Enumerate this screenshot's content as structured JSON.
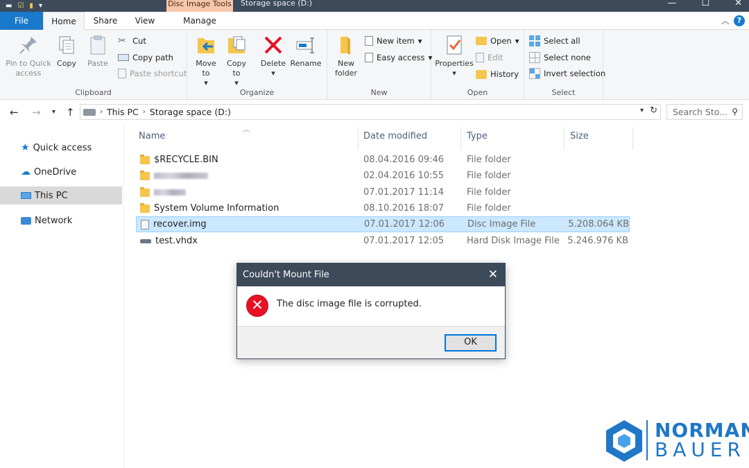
{
  "window": {
    "title": "Storage space (D:)",
    "context_tab": "Disc Image Tools",
    "controls": {
      "minimize": "—",
      "maximize": "☐",
      "close": "✕"
    }
  },
  "tabs": [
    {
      "label": "File"
    },
    {
      "label": "Home"
    },
    {
      "label": "Share"
    },
    {
      "label": "View"
    },
    {
      "label": "Manage"
    }
  ],
  "ribbon": {
    "clipboard": {
      "label": "Clipboard",
      "pin": "Pin to Quick access",
      "copy": "Copy",
      "paste": "Paste",
      "cut": "Cut",
      "copy_path": "Copy path",
      "paste_shortcut": "Paste shortcut"
    },
    "organize": {
      "label": "Organize",
      "move_to": "Move to",
      "copy_to": "Copy to",
      "delete": "Delete",
      "rename": "Rename"
    },
    "new": {
      "label": "New",
      "new_folder": "New folder",
      "new_item": "New item",
      "easy_access": "Easy access"
    },
    "open": {
      "label": "Open",
      "properties": "Properties",
      "open": "Open",
      "edit": "Edit",
      "history": "History"
    },
    "select": {
      "label": "Select",
      "select_all": "Select all",
      "select_none": "Select none",
      "invert": "Invert selection"
    }
  },
  "address": {
    "crumbs": [
      "This PC",
      "Storage space (D:)"
    ],
    "search_placeholder": "Search Sto..."
  },
  "nav": [
    {
      "label": "Quick access"
    },
    {
      "label": "OneDrive"
    },
    {
      "label": "This PC"
    },
    {
      "label": "Network"
    }
  ],
  "columns": {
    "name": "Name",
    "date": "Date modified",
    "type": "Type",
    "size": "Size"
  },
  "files": [
    {
      "name": "$RECYCLE.BIN",
      "date": "08.04.2016 09:46",
      "type": "File folder",
      "size": ""
    },
    {
      "name": "",
      "date": "02.04.2016 10:55",
      "type": "File folder",
      "size": ""
    },
    {
      "name": "",
      "date": "07.01.2017 11:14",
      "type": "File folder",
      "size": ""
    },
    {
      "name": "System Volume Information",
      "date": "08.10.2016 18:07",
      "type": "File folder",
      "size": ""
    },
    {
      "name": "recover.img",
      "date": "07.01.2017 12:06",
      "type": "Disc Image File",
      "size": "5.208.064 KB"
    },
    {
      "name": "test.vhdx",
      "date": "07.01.2017 12:05",
      "type": "Hard Disk Image File",
      "size": "5.246.976 KB"
    }
  ],
  "dialog": {
    "title": "Couldn't Mount File",
    "message": "The disc image file is corrupted.",
    "ok": "OK"
  },
  "brand": {
    "line1": "NORMAN",
    "line2": "BAUER"
  },
  "colors": {
    "accent": "#1979ca",
    "titlebar": "#3c4a5a",
    "selection": "#cce8ff",
    "error": "#e81123"
  }
}
